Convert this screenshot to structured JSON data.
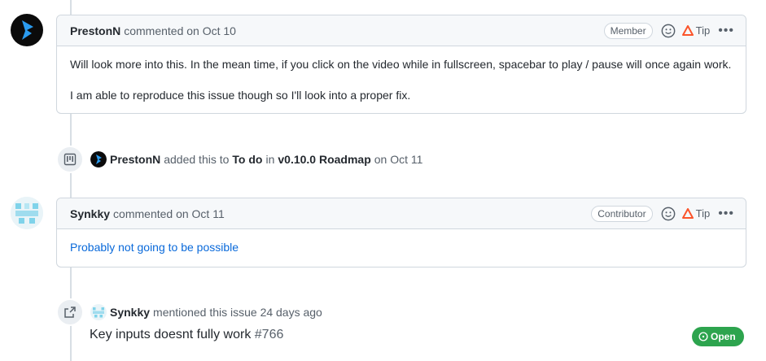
{
  "comments": [
    {
      "author": "PrestonN",
      "action": "commented on Oct 10",
      "role": "Member",
      "tip": "Tip",
      "body": [
        "Will look more into this. In the mean time, if you click on the video while in fullscreen, spacebar to play / pause will once again work.",
        "I am able to reproduce this issue though so I'll look into a proper fix."
      ]
    },
    {
      "author": "Synkky",
      "action": "commented on Oct 11",
      "role": "Contributor",
      "tip": "Tip",
      "body": [
        "Probably not going to be possible"
      ]
    }
  ],
  "events": {
    "project": {
      "actor": "PrestonN",
      "text1": "added this to",
      "column": "To do",
      "text2": "in",
      "project": "v0.10.0 Roadmap",
      "date": "on Oct 11"
    },
    "mention": {
      "actor": "Synkky",
      "text": "mentioned this issue 24 days ago",
      "issue_title": "Key inputs doesnt fully work",
      "issue_number": "#766",
      "state": "Open"
    }
  },
  "colors": {
    "accent": "#0969da",
    "open": "#2da44e",
    "brave": "#fb542b"
  }
}
